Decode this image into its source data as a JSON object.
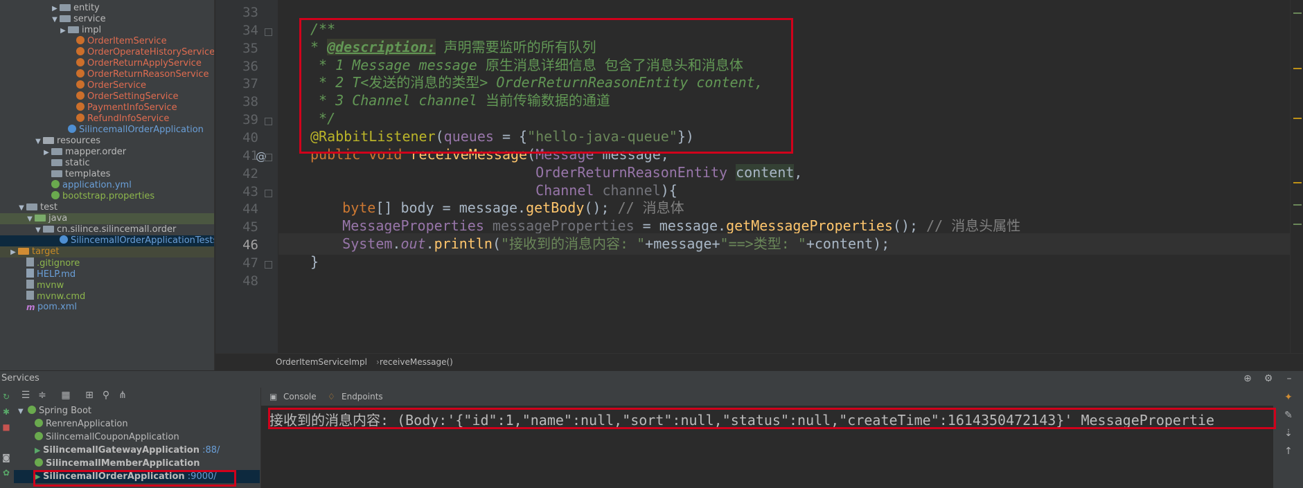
{
  "project_tree": {
    "items": [
      {
        "label": "entity",
        "kind": "folder",
        "arrow": "▶",
        "color": "default",
        "depth": 7
      },
      {
        "label": "service",
        "kind": "folder",
        "arrow": "▼",
        "color": "default",
        "depth": 7
      },
      {
        "label": "impl",
        "kind": "folder",
        "arrow": "▶",
        "color": "default",
        "depth": 8
      },
      {
        "label": "OrderItemService",
        "kind": "interface",
        "arrow": "",
        "color": "red",
        "depth": 9
      },
      {
        "label": "OrderOperateHistoryService",
        "kind": "interface",
        "arrow": "",
        "color": "red",
        "depth": 9
      },
      {
        "label": "OrderReturnApplyService",
        "kind": "interface",
        "arrow": "",
        "color": "red",
        "depth": 9
      },
      {
        "label": "OrderReturnReasonService",
        "kind": "interface",
        "arrow": "",
        "color": "red",
        "depth": 9
      },
      {
        "label": "OrderService",
        "kind": "interface",
        "arrow": "",
        "color": "red",
        "depth": 9
      },
      {
        "label": "OrderSettingService",
        "kind": "interface",
        "arrow": "",
        "color": "red",
        "depth": 9
      },
      {
        "label": "PaymentInfoService",
        "kind": "interface",
        "arrow": "",
        "color": "red",
        "depth": 9
      },
      {
        "label": "RefundInfoService",
        "kind": "interface",
        "arrow": "",
        "color": "red",
        "depth": 9
      },
      {
        "label": "SilincemallOrderApplication",
        "kind": "class",
        "arrow": "",
        "color": "blue",
        "depth": 8
      },
      {
        "label": "resources",
        "kind": "folder-res",
        "arrow": "▼",
        "color": "default",
        "depth": 5
      },
      {
        "label": "mapper.order",
        "kind": "folder",
        "arrow": "▶",
        "color": "default",
        "depth": 6
      },
      {
        "label": "static",
        "kind": "folder",
        "arrow": "",
        "color": "default",
        "depth": 6
      },
      {
        "label": "templates",
        "kind": "folder",
        "arrow": "",
        "color": "default",
        "depth": 6
      },
      {
        "label": "application.yml",
        "kind": "spring",
        "arrow": "",
        "color": "blue",
        "depth": 6
      },
      {
        "label": "bootstrap.properties",
        "kind": "spring",
        "arrow": "",
        "color": "green",
        "depth": 6
      },
      {
        "label": "test",
        "kind": "folder",
        "arrow": "▼",
        "color": "default",
        "depth": 3
      },
      {
        "label": "java",
        "kind": "folder-test",
        "arrow": "▼",
        "color": "default",
        "depth": 4,
        "selection": "green"
      },
      {
        "label": "cn.silince.silincemall.order",
        "kind": "folder",
        "arrow": "▼",
        "color": "default",
        "depth": 5
      },
      {
        "label": "SilincemallOrderApplicationTests",
        "kind": "class",
        "arrow": "",
        "color": "blue",
        "depth": 7,
        "selection": "blue"
      },
      {
        "label": "target",
        "kind": "folder-target",
        "arrow": "▶",
        "color": "gold",
        "depth": 2,
        "selection": "olive"
      },
      {
        "label": ".gitignore",
        "kind": "file",
        "arrow": "",
        "color": "green",
        "depth": 3
      },
      {
        "label": "HELP.md",
        "kind": "text",
        "arrow": "",
        "color": "blue",
        "depth": 3
      },
      {
        "label": "mvnw",
        "kind": "file",
        "arrow": "",
        "color": "green",
        "depth": 3
      },
      {
        "label": "mvnw.cmd",
        "kind": "file",
        "arrow": "",
        "color": "green",
        "depth": 3
      },
      {
        "label": "pom.xml",
        "kind": "m",
        "arrow": "",
        "color": "blue",
        "depth": 3
      }
    ]
  },
  "editor": {
    "current_line": "46",
    "lines": [
      {
        "no": "33",
        "tokens": []
      },
      {
        "no": "34",
        "tokens": [
          [
            "doc",
            "/**"
          ]
        ]
      },
      {
        "no": "35",
        "tokens": [
          [
            "doc",
            "* "
          ],
          [
            "doc-tag",
            "@description:"
          ],
          [
            "doc-cn",
            " 声明需要监听的所有队列"
          ]
        ]
      },
      {
        "no": "36",
        "tokens": [
          [
            "doc",
            " * 1 Message message "
          ],
          [
            "doc-cn",
            "原生消息详细信息 包含了消息头和消息体"
          ]
        ]
      },
      {
        "no": "37",
        "tokens": [
          [
            "doc",
            " * 2 T"
          ],
          [
            "doc-cn",
            "<发送的消息的类型>"
          ],
          [
            "doc",
            " OrderReturnReasonEntity content,"
          ]
        ]
      },
      {
        "no": "38",
        "tokens": [
          [
            "doc",
            " * 3 Channel channel "
          ],
          [
            "doc-cn",
            "当前传输数据的通道"
          ]
        ]
      },
      {
        "no": "39",
        "tokens": [
          [
            "doc",
            " */"
          ]
        ]
      },
      {
        "no": "40",
        "tokens": [
          [
            "ann",
            "@RabbitListener"
          ],
          [
            "plain",
            "("
          ],
          [
            "type",
            "queues"
          ],
          [
            "plain",
            " = {"
          ],
          [
            "str",
            "\"hello-java-queue\""
          ],
          [
            "plain",
            "})"
          ]
        ]
      },
      {
        "no": "41",
        "tokens": [
          [
            "kw",
            "public void "
          ],
          [
            "method",
            "receiveMessage"
          ],
          [
            "plain",
            "("
          ],
          [
            "type",
            "Message"
          ],
          [
            "plain",
            " message,"
          ]
        ]
      },
      {
        "no": "42",
        "tokens": [
          [
            "plain",
            "                           "
          ],
          [
            "type",
            "OrderReturnReasonEntity"
          ],
          [
            "plain",
            " "
          ],
          [
            "param-hl",
            "content"
          ],
          [
            "plain",
            ","
          ]
        ]
      },
      {
        "no": "43",
        "tokens": [
          [
            "plain",
            "                           "
          ],
          [
            "type",
            "Channel"
          ],
          [
            "unused",
            " channel"
          ],
          [
            "plain",
            "){"
          ]
        ]
      },
      {
        "no": "44",
        "tokens": [
          [
            "plain",
            "    "
          ],
          [
            "kw",
            "byte"
          ],
          [
            "plain",
            "[] body = message."
          ],
          [
            "method",
            "getBody"
          ],
          [
            "plain",
            "(); "
          ],
          [
            "comment",
            "// 消息体"
          ]
        ]
      },
      {
        "no": "45",
        "tokens": [
          [
            "plain",
            "    "
          ],
          [
            "type",
            "MessageProperties"
          ],
          [
            "unused",
            " messageProperties"
          ],
          [
            "plain",
            " = message."
          ],
          [
            "method",
            "getMessageProperties"
          ],
          [
            "plain",
            "(); "
          ],
          [
            "comment",
            "// 消息头属性"
          ]
        ]
      },
      {
        "no": "46",
        "tokens": [
          [
            "plain",
            "    "
          ],
          [
            "type",
            "System"
          ],
          [
            "plain",
            "."
          ],
          [
            "static",
            "out"
          ],
          [
            "plain",
            "."
          ],
          [
            "method",
            "println"
          ],
          [
            "plain",
            "("
          ],
          [
            "str",
            "\"接收到的消息内容: \""
          ],
          [
            "plain",
            "+message+"
          ],
          [
            "str",
            "\"==>类型: \""
          ],
          [
            "plain",
            "+content);"
          ]
        ]
      },
      {
        "no": "47",
        "tokens": [
          [
            "plain",
            "}"
          ]
        ]
      },
      {
        "no": "48",
        "tokens": []
      }
    ],
    "gutter_at": "@",
    "bulb": "💡"
  },
  "breadcrumb": {
    "items": [
      "OrderItemServiceImpl",
      "receiveMessage()"
    ],
    "separator": "›"
  },
  "services": {
    "title": "Services",
    "tree": [
      {
        "label": "Spring Boot",
        "port": "",
        "bold": false,
        "arrow": "▼",
        "running": false
      },
      {
        "label": "RenrenApplication",
        "port": "",
        "bold": false,
        "arrow": "",
        "running": false
      },
      {
        "label": "SilincemallCouponApplication",
        "port": "",
        "bold": false,
        "arrow": "",
        "running": false
      },
      {
        "label": "SilincemallGatewayApplication",
        "port": " :88/",
        "bold": true,
        "arrow": "",
        "running": true
      },
      {
        "label": "SilincemallMemberApplication",
        "port": "",
        "bold": true,
        "arrow": "",
        "running": false
      },
      {
        "label": "SilincemallOrderApplication",
        "port": " :9000/",
        "bold": true,
        "arrow": "",
        "running": true,
        "selected": true
      }
    ],
    "tabs": [
      {
        "label": "Console"
      },
      {
        "label": "Endpoints"
      }
    ],
    "console_output": "接收到的消息内容: (Body:'{\"id\":1,\"name\":null,\"sort\":null,\"status\":null,\"createTime\":1614350472143}' MessagePropertie"
  },
  "colors": {
    "highlight_box": "#d0011b",
    "panel_bg": "#3c3f41",
    "editor_bg": "#2b2b2b"
  }
}
